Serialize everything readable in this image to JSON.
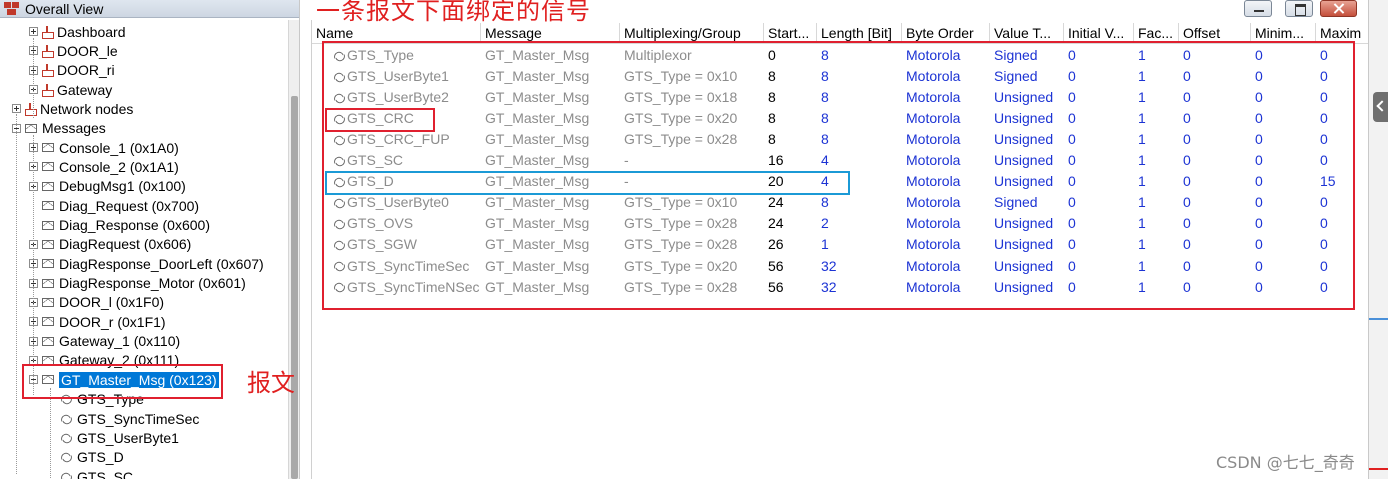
{
  "window": {
    "title": "Overall View"
  },
  "annotations": {
    "top_label": "一条报文下面绑定的信号",
    "message_label": "报文"
  },
  "tree": [
    {
      "label": "Dashboard",
      "icon": "ecu-icon",
      "indent": 2,
      "expander": "plus"
    },
    {
      "label": "DOOR_le",
      "icon": "ecu-icon",
      "indent": 2,
      "expander": "plus"
    },
    {
      "label": "DOOR_ri",
      "icon": "ecu-icon",
      "indent": 2,
      "expander": "plus"
    },
    {
      "label": "Gateway",
      "icon": "ecu-icon",
      "indent": 2,
      "expander": "plus"
    },
    {
      "label": "Network nodes",
      "icon": "ecu-icon",
      "indent": 1,
      "expander": "plus"
    },
    {
      "label": "Messages",
      "icon": "message-icon",
      "indent": 1,
      "expander": "minus"
    },
    {
      "label": "Console_1 (0x1A0)",
      "icon": "message-icon",
      "indent": 2,
      "expander": "plus"
    },
    {
      "label": "Console_2 (0x1A1)",
      "icon": "message-icon",
      "indent": 2,
      "expander": "plus"
    },
    {
      "label": "DebugMsg1 (0x100)",
      "icon": "message-icon",
      "indent": 2,
      "expander": "plus"
    },
    {
      "label": "Diag_Request (0x700)",
      "icon": "message-icon",
      "indent": 2,
      "expander": "none"
    },
    {
      "label": "Diag_Response (0x600)",
      "icon": "message-icon",
      "indent": 2,
      "expander": "none"
    },
    {
      "label": "DiagRequest (0x606)",
      "icon": "message-icon",
      "indent": 2,
      "expander": "plus"
    },
    {
      "label": "DiagResponse_DoorLeft (0x607)",
      "icon": "message-icon",
      "indent": 2,
      "expander": "plus"
    },
    {
      "label": "DiagResponse_Motor (0x601)",
      "icon": "message-icon",
      "indent": 2,
      "expander": "plus"
    },
    {
      "label": "DOOR_l (0x1F0)",
      "icon": "message-icon",
      "indent": 2,
      "expander": "plus"
    },
    {
      "label": "DOOR_r (0x1F1)",
      "icon": "message-icon",
      "indent": 2,
      "expander": "plus"
    },
    {
      "label": "Gateway_1 (0x110)",
      "icon": "message-icon",
      "indent": 2,
      "expander": "plus"
    },
    {
      "label": "Gateway_2 (0x111)",
      "icon": "message-icon",
      "indent": 2,
      "expander": "plus"
    },
    {
      "label": "GT_Master_Msg (0x123)",
      "icon": "message-icon",
      "indent": 2,
      "expander": "minus",
      "selected": true
    },
    {
      "label": "GTS_Type",
      "icon": "signal-icon",
      "indent": 3,
      "expander": "none"
    },
    {
      "label": "GTS_SyncTimeSec",
      "icon": "signal-icon",
      "indent": 3,
      "expander": "none"
    },
    {
      "label": "GTS_UserByte1",
      "icon": "signal-icon",
      "indent": 3,
      "expander": "none"
    },
    {
      "label": "GTS_D",
      "icon": "signal-icon",
      "indent": 3,
      "expander": "none"
    },
    {
      "label": "GTS_SC",
      "icon": "signal-icon",
      "indent": 3,
      "expander": "none"
    }
  ],
  "grid": {
    "columns": [
      "Name",
      "Message",
      "Multiplexing/Group",
      "Start...",
      "Length [Bit]",
      "Byte Order",
      "Value T...",
      "Initial V...",
      "Fac...",
      "Offset",
      "Minim...",
      "Maxim"
    ],
    "rows": [
      [
        "GTS_Type",
        "GT_Master_Msg",
        "Multiplexor",
        "0",
        "8",
        "Motorola",
        "Signed",
        "0",
        "1",
        "0",
        "0",
        "0"
      ],
      [
        "GTS_UserByte1",
        "GT_Master_Msg",
        "GTS_Type = 0x10",
        "8",
        "8",
        "Motorola",
        "Signed",
        "0",
        "1",
        "0",
        "0",
        "0"
      ],
      [
        "GTS_UserByte2",
        "GT_Master_Msg",
        "GTS_Type = 0x18",
        "8",
        "8",
        "Motorola",
        "Unsigned",
        "0",
        "1",
        "0",
        "0",
        "0"
      ],
      [
        "GTS_CRC",
        "GT_Master_Msg",
        "GTS_Type = 0x20",
        "8",
        "8",
        "Motorola",
        "Unsigned",
        "0",
        "1",
        "0",
        "0",
        "0"
      ],
      [
        "GTS_CRC_FUP",
        "GT_Master_Msg",
        "GTS_Type = 0x28",
        "8",
        "8",
        "Motorola",
        "Unsigned",
        "0",
        "1",
        "0",
        "0",
        "0"
      ],
      [
        "GTS_SC",
        "GT_Master_Msg",
        "-",
        "16",
        "4",
        "Motorola",
        "Unsigned",
        "0",
        "1",
        "0",
        "0",
        "0"
      ],
      [
        "GTS_D",
        "GT_Master_Msg",
        "-",
        "20",
        "4",
        "Motorola",
        "Unsigned",
        "0",
        "1",
        "0",
        "0",
        "15"
      ],
      [
        "GTS_UserByte0",
        "GT_Master_Msg",
        "GTS_Type = 0x10",
        "24",
        "8",
        "Motorola",
        "Signed",
        "0",
        "1",
        "0",
        "0",
        "0"
      ],
      [
        "GTS_OVS",
        "GT_Master_Msg",
        "GTS_Type = 0x28",
        "24",
        "2",
        "Motorola",
        "Unsigned",
        "0",
        "1",
        "0",
        "0",
        "0"
      ],
      [
        "GTS_SGW",
        "GT_Master_Msg",
        "GTS_Type = 0x28",
        "26",
        "1",
        "Motorola",
        "Unsigned",
        "0",
        "1",
        "0",
        "0",
        "0"
      ],
      [
        "GTS_SyncTimeSec",
        "GT_Master_Msg",
        "GTS_Type = 0x20",
        "56",
        "32",
        "Motorola",
        "Unsigned",
        "0",
        "1",
        "0",
        "0",
        "0"
      ],
      [
        "GTS_SyncTimeNSec",
        "GT_Master_Msg",
        "GTS_Type = 0x28",
        "56",
        "32",
        "Motorola",
        "Unsigned",
        "0",
        "1",
        "0",
        "0",
        "0"
      ]
    ]
  },
  "watermark": "CSDN @七七_奇奇",
  "colors": {
    "annotation_red": "#e02020",
    "highlight_blue": "#1b9ad6",
    "value_blue": "#1c33d4",
    "selection": "#0078d7"
  }
}
